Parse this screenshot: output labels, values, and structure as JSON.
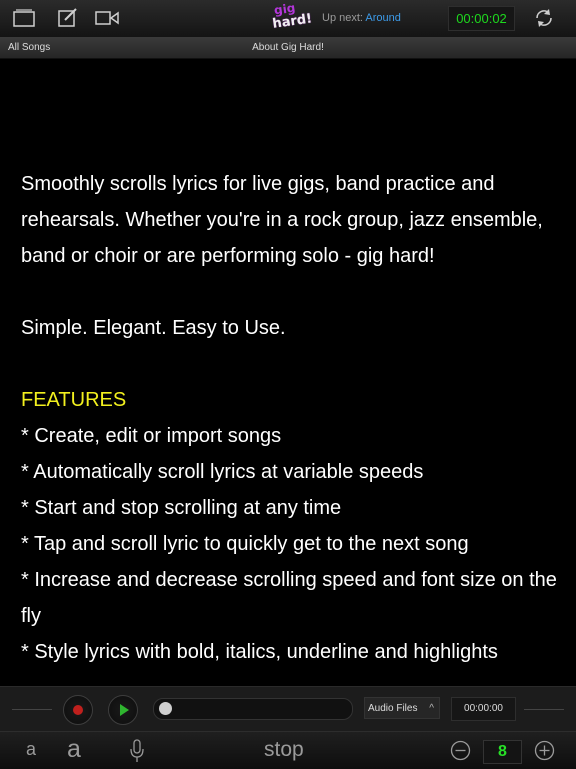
{
  "topbar": {
    "logo_line1": "gig",
    "logo_line2": "hard!",
    "upnext_label": "Up next:",
    "upnext_song": "Around",
    "timer": "00:00:02",
    "icons": [
      "song-list-icon",
      "edit-icon",
      "video-icon",
      "sync-icon"
    ]
  },
  "subbar": {
    "all_songs": "All Songs",
    "title": "About Gig Hard!"
  },
  "lyrics": {
    "para1": "Smoothly scrolls lyrics for live gigs, band practice and rehearsals. Whether you're in a rock group, jazz ensemble, band or choir or are performing solo - gig hard!",
    "para2": "Simple. Elegant. Easy to Use.",
    "features_heading": "FEATURES",
    "features": [
      "* Create, edit or import songs",
      "* Automatically scroll lyrics at variable speeds",
      "* Start and stop scrolling at any time",
      "* Tap and scroll lyric to quickly get to the next song",
      "* Increase and decrease scrolling speed and font size on the fly",
      "* Style lyrics with bold, italics, underline and highlights"
    ]
  },
  "player": {
    "audio_select": "Audio Files",
    "time": "00:00:00",
    "progress": 0
  },
  "bottombar": {
    "font_small": "a",
    "font_large": "a",
    "stop_label": "stop",
    "speed_value": "8"
  },
  "colors": {
    "accent_green": "#1ed81e",
    "upnext_blue": "#3d9be9",
    "features_yellow": "#f2f01e",
    "record_red": "#c0201d"
  }
}
